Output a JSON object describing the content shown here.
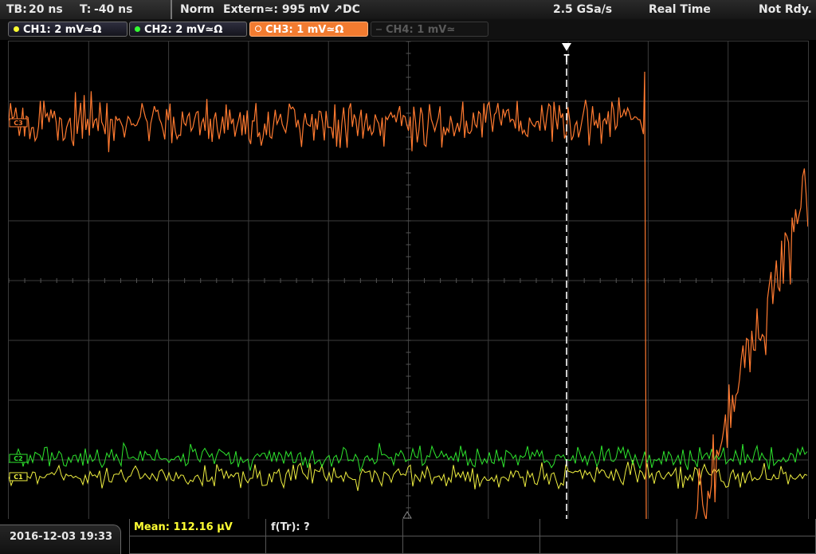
{
  "topbar": {
    "tb_label": "TB:",
    "tb_value": "20 ns",
    "t_label": "T:",
    "t_value": "-40 ns",
    "trigger_mode": "Norm",
    "trigger_source": "Extern≃: 995 mV ↗DC",
    "sample_rate": "2.5 GSa/s",
    "acq_mode": "Real Time",
    "status": "Not Rdy."
  },
  "channels": [
    {
      "label": "CH1: 2 mV≃Ω",
      "color": "#ffff33",
      "state": "on"
    },
    {
      "label": "CH2: 2 mV≃Ω",
      "color": "#33ff33",
      "state": "on"
    },
    {
      "label": "CH3: 1 mV≃Ω",
      "color": "#ff8a3d",
      "state": "active"
    },
    {
      "label": "CH4: 1 mV≃",
      "color": "#4a4a4a",
      "state": "off"
    }
  ],
  "markers": {
    "trigger_marker": "T",
    "ch3_marker": "C3",
    "ch2_marker": "C2",
    "ch1_marker": "C1"
  },
  "footer": {
    "datetime": "2016-12-03 19:33",
    "mean_label": "Mean: 112.16 µV",
    "ftr_label": "f(Tr): ?"
  },
  "colors": {
    "ch1": "#f0f040",
    "ch2": "#2ee62e",
    "ch3": "#ff7a30",
    "grid": "#3c3c3c",
    "mean_text": "#ffff33"
  }
}
